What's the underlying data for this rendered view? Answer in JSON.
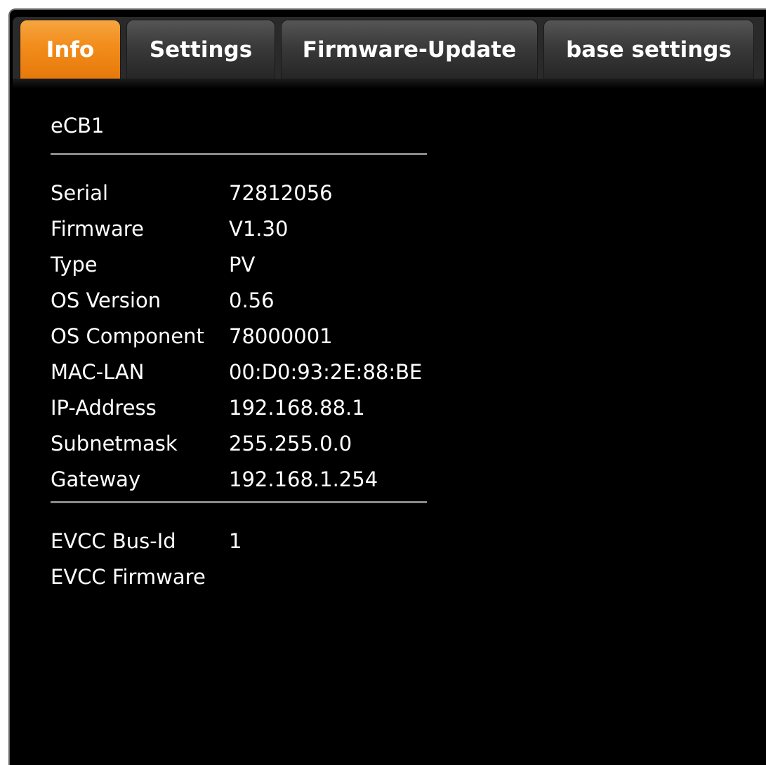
{
  "tabs": [
    {
      "label": "Info",
      "active": true
    },
    {
      "label": "Settings",
      "active": false
    },
    {
      "label": "Firmware-Update",
      "active": false
    },
    {
      "label": "base settings",
      "active": false
    }
  ],
  "colors": {
    "active_tab": "#f28c1a",
    "inactive_tab": "#3a3a3a",
    "background": "#000000",
    "text": "#ffffff"
  },
  "device": {
    "name": "eCB1"
  },
  "info_rows": [
    {
      "label": "Serial",
      "value": "72812056"
    },
    {
      "label": "Firmware",
      "value": "V1.30"
    },
    {
      "label": "Type",
      "value": "PV"
    },
    {
      "label": "OS Version",
      "value": "0.56"
    },
    {
      "label": "OS Component",
      "value": "78000001"
    },
    {
      "label": "MAC-LAN",
      "value": "00:D0:93:2E:88:BE"
    },
    {
      "label": "IP-Address",
      "value": "192.168.88.1"
    },
    {
      "label": "Subnetmask",
      "value": "255.255.0.0"
    },
    {
      "label": "Gateway",
      "value": "192.168.1.254"
    }
  ],
  "evcc_rows": [
    {
      "label": "EVCC Bus-Id",
      "value": "1"
    },
    {
      "label": "EVCC Firmware",
      "value": ""
    }
  ]
}
